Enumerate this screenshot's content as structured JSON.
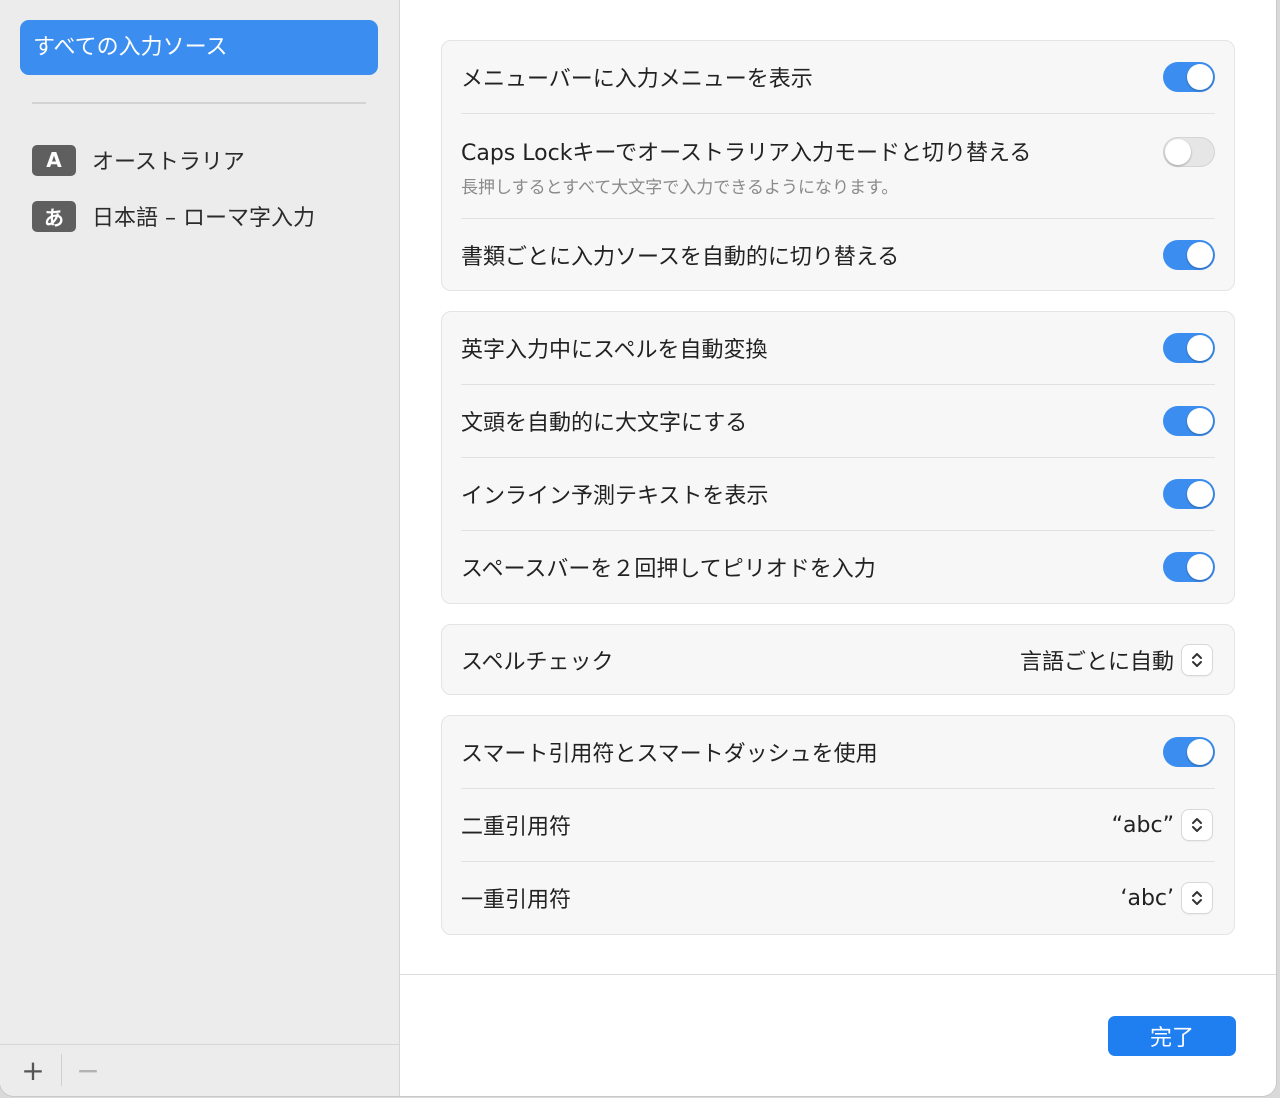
{
  "sidebar": {
    "selected_label": "すべての入力ソース",
    "sources": [
      {
        "badge": "A",
        "label": "オーストラリア"
      },
      {
        "badge": "あ",
        "label": "日本語 – ローマ字入力"
      }
    ],
    "add_label": "+",
    "remove_label": "−"
  },
  "settings": {
    "group1": {
      "show_input_menu": {
        "label": "メニューバーに入力メニューを表示",
        "enabled": true
      },
      "caps_lock_switch": {
        "label": "Caps Lockキーでオーストラリア入力モードと切り替える",
        "sublabel": "長押しするとすべて大文字で入力できるようになります。",
        "enabled": false
      },
      "auto_switch_per_document": {
        "label": "書類ごとに入力ソースを自動的に切り替える",
        "enabled": true
      }
    },
    "group2": {
      "auto_correct": {
        "label": "英字入力中にスペルを自動変換",
        "enabled": true
      },
      "auto_capitalize": {
        "label": "文頭を自動的に大文字にする",
        "enabled": true
      },
      "inline_predictive": {
        "label": "インライン予測テキストを表示",
        "enabled": true
      },
      "double_space_period": {
        "label": "スペースバーを２回押してピリオドを入力",
        "enabled": true
      }
    },
    "group3": {
      "spell_check": {
        "label": "スペルチェック",
        "value": "言語ごとに自動"
      }
    },
    "group4": {
      "smart_quotes": {
        "label": "スマート引用符とスマートダッシュを使用",
        "enabled": true
      },
      "double_quotes": {
        "label": "二重引用符",
        "value": "“abc”"
      },
      "single_quotes": {
        "label": "一重引用符",
        "value": "‘abc’"
      }
    }
  },
  "footer": {
    "done_label": "完了"
  },
  "colors": {
    "accent": "#3b8ef0",
    "sidebar_bg": "#ececec",
    "button": "#1f7ff0"
  },
  "icons": {
    "toggle": "switch-toggle",
    "stepper": "chevron-up-down-icon"
  }
}
